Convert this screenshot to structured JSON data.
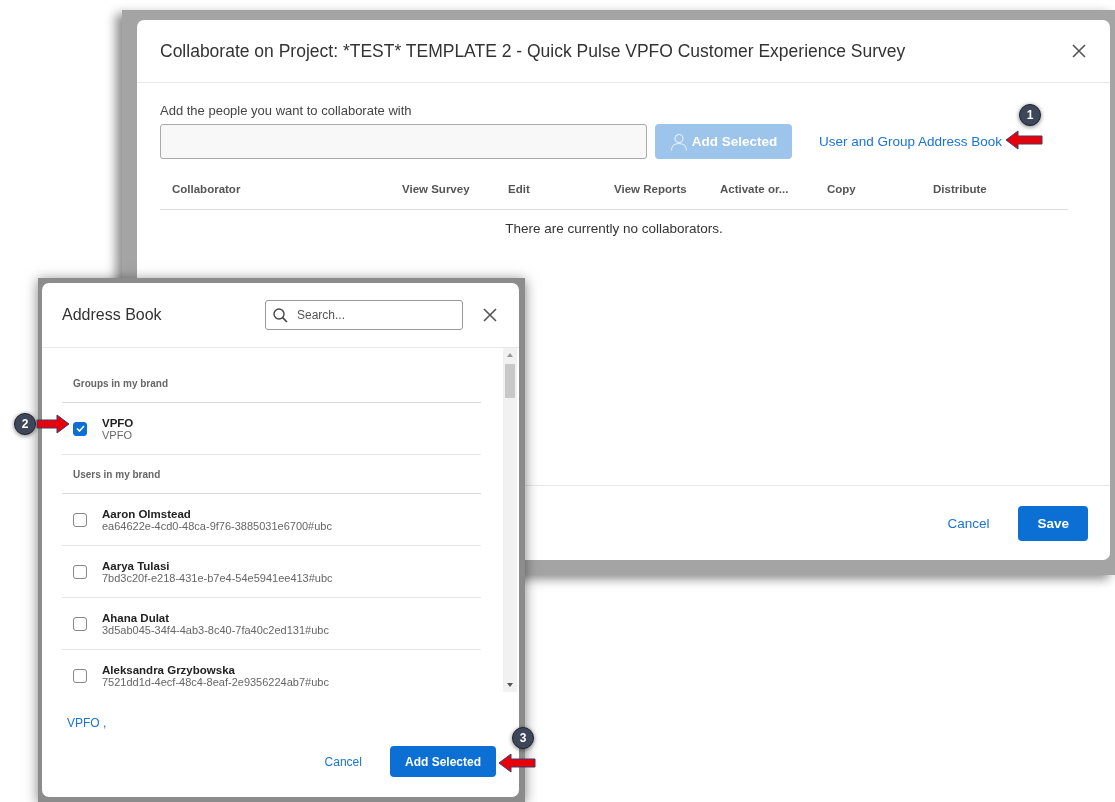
{
  "collaborate_dialog": {
    "title": "Collaborate on Project: *TEST* TEMPLATE 2 - Quick Pulse VPFO Customer Experience Survey",
    "prompt_label": "Add the people you want to collaborate with",
    "add_button": {
      "label": "Add Selected",
      "disabled": true
    },
    "address_book_link": "User and Group Address Book",
    "table": {
      "columns": [
        "Collaborator",
        "View Survey",
        "Edit",
        "View Reports",
        "Activate or...",
        "Copy",
        "Distribute"
      ],
      "empty_message": "There are currently no collaborators."
    },
    "buttons": [
      {
        "label": "Cancel",
        "kind": "link"
      },
      {
        "label": "Save",
        "kind": "primary"
      }
    ]
  },
  "address_book": {
    "title": "Address Book",
    "search": {
      "placeholder": "Search..."
    },
    "sections": [
      {
        "heading": "Groups in my brand",
        "items": [
          {
            "name": "VPFO",
            "detail": "VPFO",
            "checked": true
          }
        ]
      },
      {
        "heading": "Users in my brand",
        "items": [
          {
            "name": "Aaron Olmstead",
            "detail": "ea64622e-4cd0-48ca-9f76-3885031e6700#ubc",
            "checked": false
          },
          {
            "name": "Aarya Tulasi",
            "detail": "7bd3c20f-e218-431e-b7e4-54e5941ee413#ubc",
            "checked": false
          },
          {
            "name": "Ahana Dulat",
            "detail": "3d5ab045-34f4-4ab3-8c40-7fa40c2ed131#ubc",
            "checked": false
          },
          {
            "name": "Aleksandra Grzybowska",
            "detail": "7521dd1d-4ecf-48c4-8eaf-2e9356224ab7#ubc",
            "checked": false
          }
        ]
      }
    ],
    "selection_summary": "VPFO ,",
    "buttons": [
      {
        "label": "Cancel",
        "kind": "link"
      },
      {
        "label": "Add Selected",
        "kind": "primary"
      }
    ]
  },
  "callouts": [
    {
      "number": "1"
    },
    {
      "number": "2"
    },
    {
      "number": "3"
    }
  ]
}
